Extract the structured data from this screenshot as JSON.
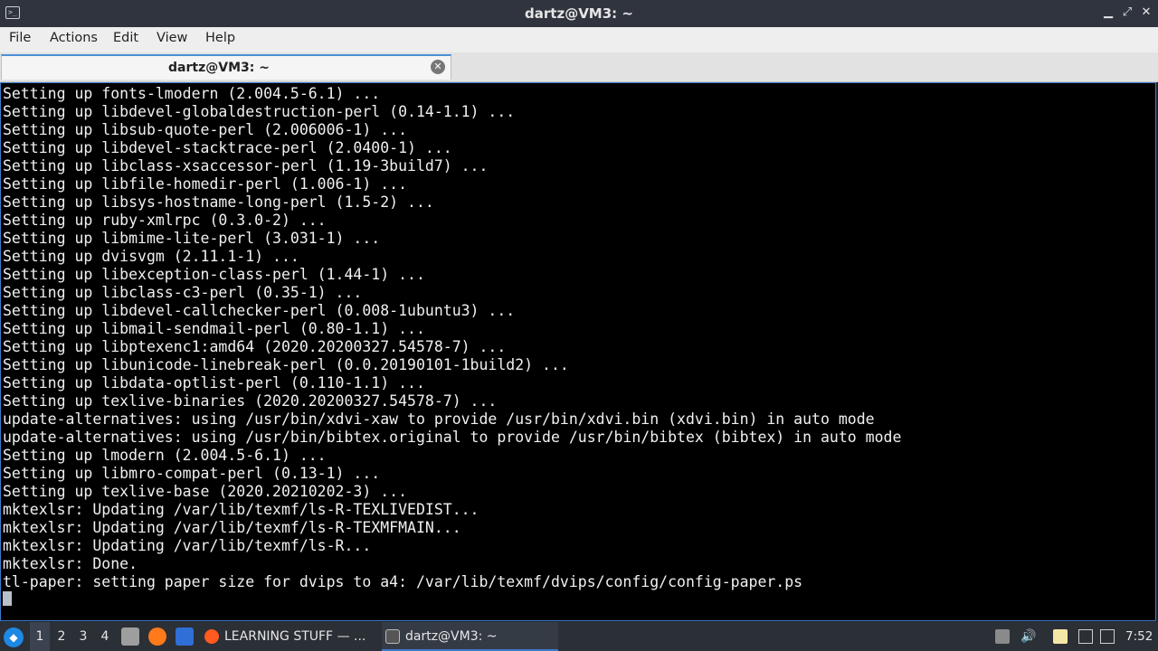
{
  "window": {
    "title": "dartz@VM3: ~",
    "app_icon_glyph": ">_",
    "controls": {
      "minimize": "▁",
      "maximize": "⤢",
      "close": "✕"
    }
  },
  "menu": {
    "items": [
      "File",
      "Actions",
      "Edit",
      "View",
      "Help"
    ]
  },
  "tab": {
    "label": "dartz@VM3: ~",
    "close_icon": "✕"
  },
  "terminal": {
    "lines": [
      "Setting up fonts-lmodern (2.004.5-6.1) ...",
      "Setting up libdevel-globaldestruction-perl (0.14-1.1) ...",
      "Setting up libsub-quote-perl (2.006006-1) ...",
      "Setting up libdevel-stacktrace-perl (2.0400-1) ...",
      "Setting up libclass-xsaccessor-perl (1.19-3build7) ...",
      "Setting up libfile-homedir-perl (1.006-1) ...",
      "Setting up libsys-hostname-long-perl (1.5-2) ...",
      "Setting up ruby-xmlrpc (0.3.0-2) ...",
      "Setting up libmime-lite-perl (3.031-1) ...",
      "Setting up dvisvgm (2.11.1-1) ...",
      "Setting up libexception-class-perl (1.44-1) ...",
      "Setting up libclass-c3-perl (0.35-1) ...",
      "Setting up libdevel-callchecker-perl (0.008-1ubuntu3) ...",
      "Setting up libmail-sendmail-perl (0.80-1.1) ...",
      "Setting up libptexenc1:amd64 (2020.20200327.54578-7) ...",
      "Setting up libunicode-linebreak-perl (0.0.20190101-1build2) ...",
      "Setting up libdata-optlist-perl (0.110-1.1) ...",
      "Setting up texlive-binaries (2020.20200327.54578-7) ...",
      "update-alternatives: using /usr/bin/xdvi-xaw to provide /usr/bin/xdvi.bin (xdvi.bin) in auto mode",
      "update-alternatives: using /usr/bin/bibtex.original to provide /usr/bin/bibtex (bibtex) in auto mode",
      "Setting up lmodern (2.004.5-6.1) ...",
      "Setting up libmro-compat-perl (0.13-1) ...",
      "Setting up texlive-base (2020.20210202-3) ...",
      "mktexlsr: Updating /var/lib/texmf/ls-R-TEXLIVEDIST...",
      "mktexlsr: Updating /var/lib/texmf/ls-R-TEXMFMAIN...",
      "mktexlsr: Updating /var/lib/texmf/ls-R...",
      "mktexlsr: Done.",
      "tl-paper: setting paper size for dvips to a4: /var/lib/texmf/dvips/config/config-paper.ps"
    ]
  },
  "taskbar": {
    "workspaces": [
      "1",
      "2",
      "3",
      "4"
    ],
    "active_workspace": "1",
    "tasks": [
      {
        "label": "LEARNING STUFF — ...",
        "icon": "firefox-icon"
      },
      {
        "label": "dartz@VM3: ~",
        "icon": "terminal-icon"
      }
    ],
    "clock": "7:52",
    "colors": {
      "accent": "#3d7ac9",
      "panel": "#2b2f36"
    }
  }
}
